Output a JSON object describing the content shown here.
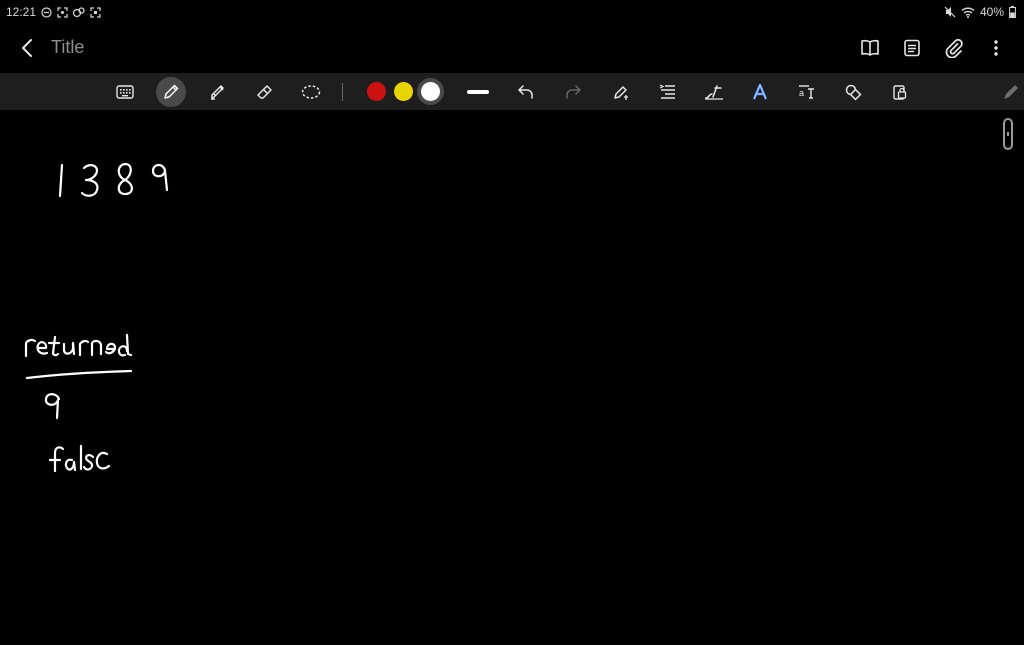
{
  "status_bar": {
    "time": "12:21",
    "battery": "40%",
    "left_icons": [
      "do-not-disturb-icon",
      "screenshot-icon",
      "app-notification-icon",
      "screen-record-icon"
    ],
    "right_icons": [
      "mute-icon",
      "wifi-icon",
      "battery-icon"
    ]
  },
  "app_bar": {
    "title": "Title",
    "actions": [
      "book-view-icon",
      "page-list-icon",
      "attach-icon",
      "more-options-icon"
    ]
  },
  "toolbar": {
    "tools": [
      "keyboard-icon",
      "pen-icon",
      "highlighter-icon",
      "eraser-icon",
      "lasso-icon"
    ],
    "colors": [
      "#cc1111",
      "#e8d400",
      "#ffffff"
    ],
    "selected_color": "#ffffff",
    "actions": [
      "stroke-width-icon",
      "undo-icon",
      "redo-icon",
      "pen-to-text-icon",
      "text-align-icon",
      "handwriting-straighten-icon",
      "text-style-icon",
      "text-box-icon",
      "shapes-icon",
      "lock-icon",
      "pen-mode-icon"
    ]
  },
  "canvas": {
    "ink_color": "#ffffff",
    "handwriting": [
      "1 3 8 9",
      "returned",
      "9",
      "false"
    ]
  }
}
